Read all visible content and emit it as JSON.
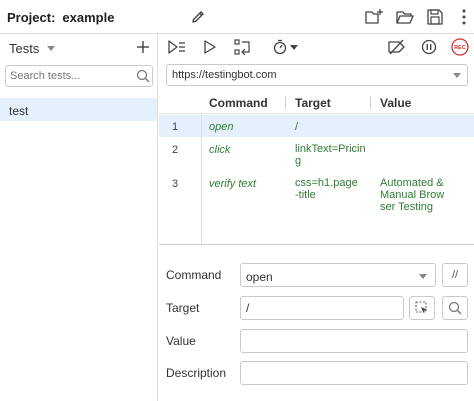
{
  "header": {
    "project_label": "Project:",
    "project_name": "example",
    "icons": [
      "pencil-icon",
      "new-suite-folder-icon",
      "open-folder-icon",
      "save-icon",
      "more-vertical-icon"
    ]
  },
  "sidebar": {
    "title": "Tests",
    "search_placeholder": "Search tests...",
    "items": [
      {
        "label": "test",
        "selected": true
      }
    ]
  },
  "toolbar": {
    "icons": [
      "run-all-tests-icon",
      "run-test-icon",
      "step-over-icon",
      "speed-timer-icon",
      "disable-breakpoints-icon",
      "pause-icon",
      "record-icon"
    ],
    "record_label": "REC"
  },
  "url": {
    "value": "https://testingbot.com"
  },
  "table": {
    "columns": [
      "Command",
      "Target",
      "Value"
    ],
    "rows": [
      {
        "num": "1",
        "command": "open",
        "target": "/",
        "value": "",
        "selected": true
      },
      {
        "num": "2",
        "command": "click",
        "target": "linkText=Pricing",
        "value": ""
      },
      {
        "num": "3",
        "command": "verify text",
        "target": "css=h1.page-title",
        "value": "Automated & Manual Browser Testing"
      }
    ]
  },
  "form": {
    "command_label": "Command",
    "command_value": "open",
    "comment_toggle_label": "//",
    "target_label": "Target",
    "target_value": "/",
    "value_label": "Value",
    "value_value": "",
    "description_label": "Description",
    "description_value": ""
  },
  "colors": {
    "accent": "#e4f1fc",
    "green_text": "#2e7d32",
    "record_red": "#d32f2f"
  }
}
